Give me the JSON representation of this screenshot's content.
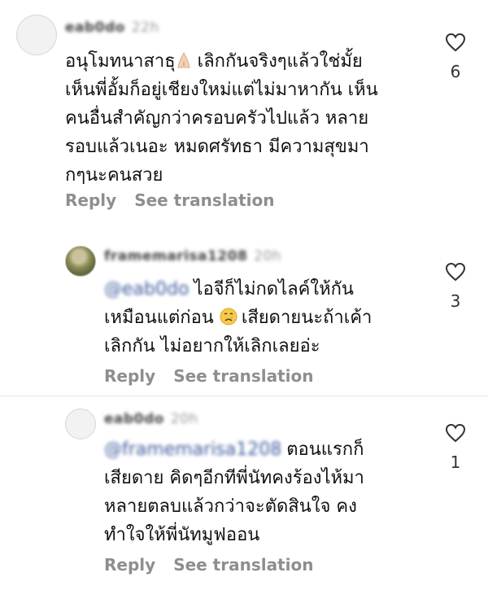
{
  "comments": [
    {
      "username": "eab0do",
      "time": "22h",
      "lines": [
        "อนุโมทนาสาธุ",
        "เห็นพี่อั้มก็อยู่เชียงใหม่แต่ไม่มาหากัน เห็น",
        "คนอื่นสำคัญกว่าครอบครัวไปแล้ว หลาย",
        "รอบแล้วเนอะ หมดศรัทธา มีความสุขมา",
        "กๆนะคนสวย"
      ],
      "line1_suffix": " เลิกกันจริงๆแล้วใช่มั้ย",
      "reply_label": "Reply",
      "translate_label": "See translation",
      "likes": "6"
    },
    {
      "username": "framemarisa1208",
      "time": "20h",
      "mention": "@eab0do",
      "lines": [
        "ไอจีก็ไม่กดไลค์ให้กัน",
        "เหมือนแต่ก่อน",
        "เลิกกัน ไม่อยากให้เลิกเลยอ่ะ"
      ],
      "line2_suffix": " เสียดายนะถ้าเค้า",
      "reply_label": "Reply",
      "translate_label": "See translation",
      "likes": "3"
    },
    {
      "username": "eab0do",
      "time": "20h",
      "mention": "@framemarisa1208",
      "lines": [
        "ตอนแรกก็",
        "เสียดาย คิดๆอีกทีพี่นัทคงร้องไห้มา",
        "หลายตลบแล้วกว่าจะตัดสินใจ คง",
        "ทำใจให้พี่นัทมูฟออน"
      ],
      "reply_label": "Reply",
      "translate_label": "See translation",
      "likes": "1"
    }
  ],
  "icons": {
    "like": "heart-icon",
    "emoji1": "folded-hands-emoji",
    "emoji2": "crying-face-emoji"
  },
  "colors": {
    "action_gray": "#8e8e8e",
    "mention_blue": "#3d5a9e",
    "text": "#111111"
  }
}
